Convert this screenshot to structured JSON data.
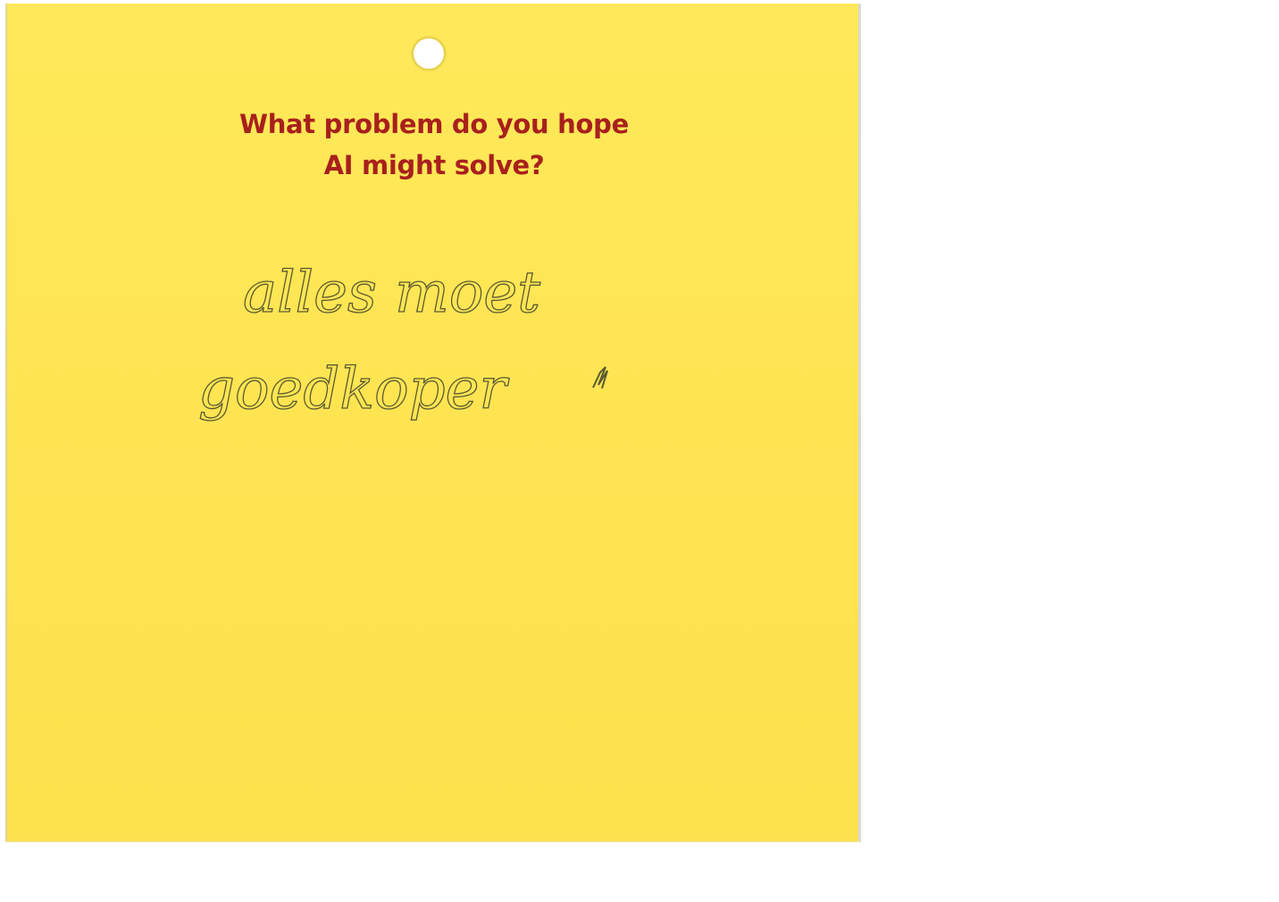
{
  "card": {
    "prompt_line_1": "What problem do you hope",
    "prompt_line_2": "AI might solve?",
    "answer_line_1": "alles moet",
    "answer_line_2": "goedkoper"
  },
  "colors": {
    "card_background": "#ffe553",
    "prompt_text": "#a8201d",
    "handwriting_ink": "#5a5a33",
    "page_background": "#ffffff"
  }
}
